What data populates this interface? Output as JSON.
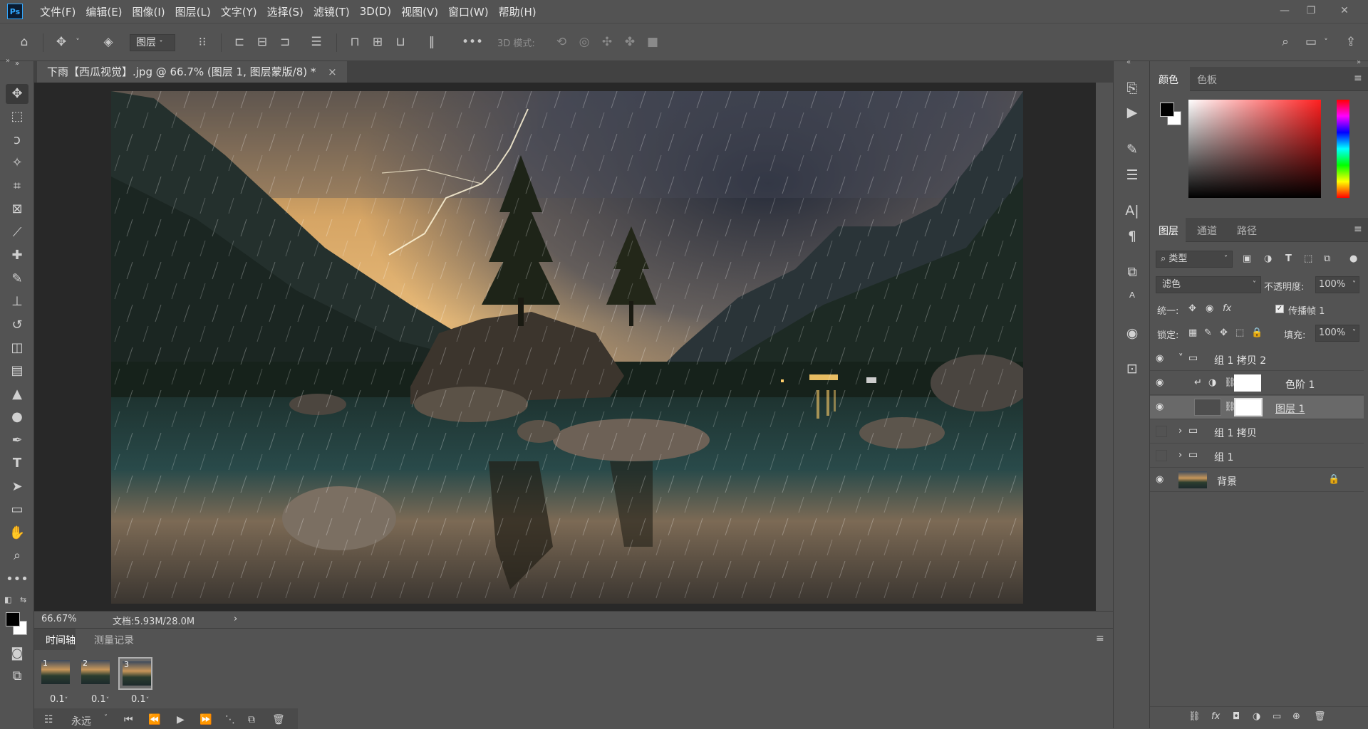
{
  "app": {
    "logo": "Ps",
    "menu": [
      "文件(F)",
      "编辑(E)",
      "图像(I)",
      "图层(L)",
      "文字(Y)",
      "选择(S)",
      "滤镜(T)",
      "3D(D)",
      "视图(V)",
      "窗口(W)",
      "帮助(H)"
    ]
  },
  "options_bar": {
    "layer_select": "图层",
    "mode_label": "3D 模式:"
  },
  "document": {
    "tab_title": "下雨【西瓜视觉】.jpg @ 66.7% (图层 1, 图层蒙版/8) *",
    "close": "×",
    "zoom": "66.67%",
    "doc_info": "文档:5.93M/28.0M",
    "arrow": "›"
  },
  "timeline": {
    "tabs": [
      "时间轴",
      "测量记录"
    ],
    "frames": [
      {
        "num": "1",
        "delay": "0.1",
        "arrow": "˅"
      },
      {
        "num": "2",
        "delay": "0.1",
        "arrow": "˅"
      },
      {
        "num": "3",
        "delay": "0.1",
        "arrow": "˅"
      }
    ],
    "loop": "永远"
  },
  "color_panel": {
    "tabs": [
      "颜色",
      "色板"
    ],
    "accent": "#ff1f1f"
  },
  "layers_panel": {
    "tabs": [
      "图层",
      "通道",
      "路径"
    ],
    "filter_kind": "类型",
    "blend_mode": "滤色",
    "opacity_label": "不透明度:",
    "opacity_value": "100%",
    "unify_label": "统一:",
    "propagate_label": "传播帧 1",
    "lock_label": "锁定:",
    "fill_label": "填充:",
    "fill_value": "100%",
    "layers": [
      {
        "name": "组 1 拷贝 2",
        "visible": true
      },
      {
        "name": "色阶 1",
        "visible": true
      },
      {
        "name": "图层 1",
        "visible": true,
        "selected": true
      },
      {
        "name": "组 1 拷贝",
        "visible": false
      },
      {
        "name": "组 1",
        "visible": false
      },
      {
        "name": "背景",
        "visible": true
      }
    ]
  }
}
